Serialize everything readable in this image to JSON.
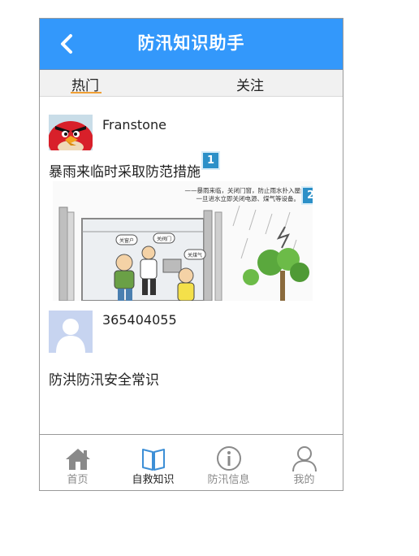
{
  "header": {
    "title": "防汛知识助手",
    "back_icon": "chevron-left-icon",
    "color": "#3398fb"
  },
  "tabs": [
    {
      "label": "热门",
      "active": true
    },
    {
      "label": "关注",
      "active": false
    }
  ],
  "posts": [
    {
      "user": "Franstone",
      "avatar_icon": "angry-bird-avatar",
      "title": "暴雨来临时采取防范措施",
      "badge": "1"
    },
    {
      "user": "365404055",
      "avatar_icon": "default-user-avatar",
      "title": "防洪防汛安全常识"
    }
  ],
  "illustration": {
    "badge": "2",
    "caption_line1": "——暴雨来临，关闭门窗，防止雨水扑入屋内，",
    "caption_line2": "一旦进水立即关闭电源、煤气等设备。",
    "bubble1": "关窗户",
    "bubble2": "关阀门",
    "bubble3": "关煤气"
  },
  "bottom_nav": [
    {
      "label": "首页",
      "icon": "home-icon",
      "active": false
    },
    {
      "label": "自救知识",
      "icon": "book-icon",
      "active": true
    },
    {
      "label": "防汛信息",
      "icon": "info-icon",
      "active": false
    },
    {
      "label": "我的",
      "icon": "user-icon",
      "active": false
    }
  ]
}
